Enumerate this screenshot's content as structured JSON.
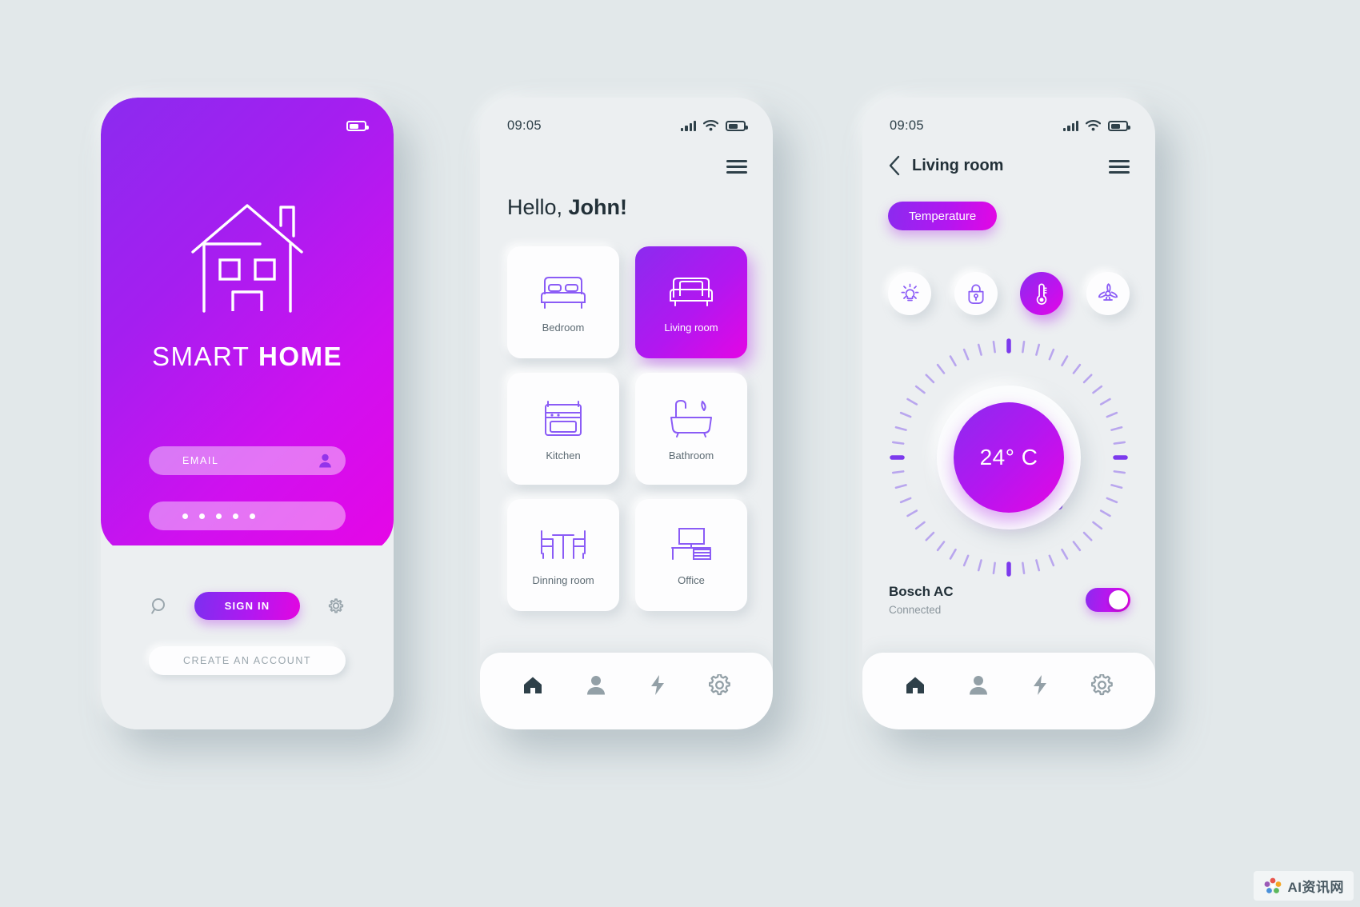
{
  "statusbar": {
    "time": "09:05",
    "signal_icon": "signal-bars-icon",
    "wifi_icon": "wifi-icon",
    "battery_icon": "battery-icon"
  },
  "login": {
    "logo_icon": "house-outline-icon",
    "brand_light": "SMART",
    "brand_bold": "HOME",
    "email_placeholder": "EMAIL",
    "email_icon": "user-icon",
    "password_masked": "• • • • •",
    "password_dots": 5,
    "search_icon": "search-icon",
    "signin_label": "SIGN IN",
    "settings_icon": "gear-icon",
    "create_account_label": "CREATE AN ACCOUNT"
  },
  "home": {
    "menu_icon": "hamburger-menu-icon",
    "greeting_prefix": "Hello, ",
    "greeting_name": "John!",
    "rooms": [
      {
        "label": "Bedroom",
        "icon": "bed-icon",
        "active": false
      },
      {
        "label": "Living room",
        "icon": "sofa-icon",
        "active": true
      },
      {
        "label": "Kitchen",
        "icon": "stove-icon",
        "active": false
      },
      {
        "label": "Bathroom",
        "icon": "bathtub-icon",
        "active": false
      },
      {
        "label": "Dinning room",
        "icon": "table-chairs-icon",
        "active": false
      },
      {
        "label": "Office",
        "icon": "desk-icon",
        "active": false
      }
    ],
    "nav": [
      {
        "icon": "home-icon",
        "label": "Home",
        "active": true
      },
      {
        "icon": "user-icon",
        "label": "Profile",
        "active": false
      },
      {
        "icon": "bolt-icon",
        "label": "Energy",
        "active": false
      },
      {
        "icon": "gear-icon",
        "label": "Settings",
        "active": false
      }
    ]
  },
  "room_detail": {
    "back_icon": "chevron-left-icon",
    "title": "Living room",
    "menu_icon": "hamburger-menu-icon",
    "chip_label": "Temperature",
    "modes": [
      {
        "icon": "lightbulb-icon",
        "label": "Light",
        "active": false
      },
      {
        "icon": "lock-icon",
        "label": "Lock",
        "active": false
      },
      {
        "icon": "thermometer-icon",
        "label": "Temperature",
        "active": true
      },
      {
        "icon": "fan-icon",
        "label": "Fan",
        "active": false
      }
    ],
    "temperature": "24° C",
    "device_name": "Bosch AC",
    "device_status": "Connected",
    "toggle_on": true,
    "nav": [
      {
        "icon": "home-icon",
        "label": "Home",
        "active": true
      },
      {
        "icon": "user-icon",
        "label": "Profile",
        "active": false
      },
      {
        "icon": "bolt-icon",
        "label": "Energy",
        "active": false
      },
      {
        "icon": "gear-icon",
        "label": "Settings",
        "active": false
      }
    ]
  },
  "watermark": {
    "text": "AI资讯网"
  },
  "colors": {
    "gradient_start": "#8b2bef",
    "gradient_end": "#e406e4",
    "page_bg": "#e2e8ea",
    "card_bg": "#fdfdfe",
    "text_dark": "#223038",
    "text_muted": "#8b969d",
    "accent_purple": "#8b5cf6"
  }
}
